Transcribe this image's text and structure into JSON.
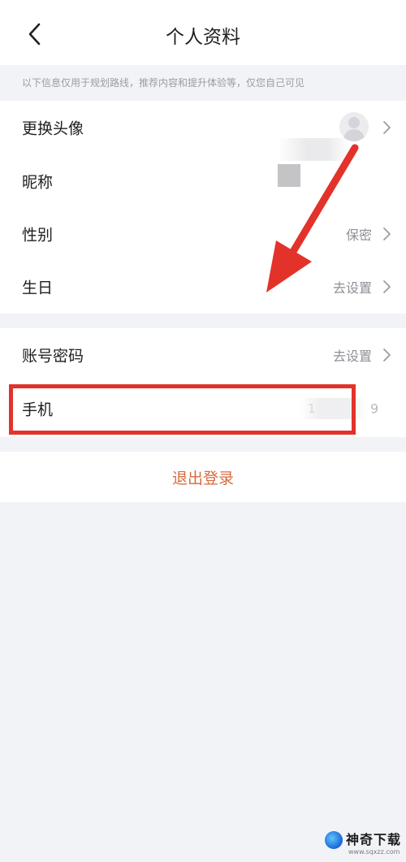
{
  "header": {
    "title": "个人资料",
    "back_icon": "chevron-left-icon"
  },
  "notice": "以下信息仅用于规划路线，推荐内容和提升体验等，仅您自己可见",
  "profile_rows": [
    {
      "label": "更换头像",
      "value": ""
    },
    {
      "label": "昵称",
      "value": ""
    },
    {
      "label": "性别",
      "value": "保密"
    },
    {
      "label": "生日",
      "value": "去设置"
    }
  ],
  "account_rows": [
    {
      "label": "账号密码",
      "value": "去设置"
    },
    {
      "label": "手机",
      "value_start": "1",
      "value_end": "9"
    }
  ],
  "logout_label": "退出登录",
  "colors": {
    "annotation": "#e2322a",
    "logout_text": "#d76a3c"
  },
  "watermark": {
    "brand": "神奇下载",
    "url": "www.sqxzz.com"
  }
}
